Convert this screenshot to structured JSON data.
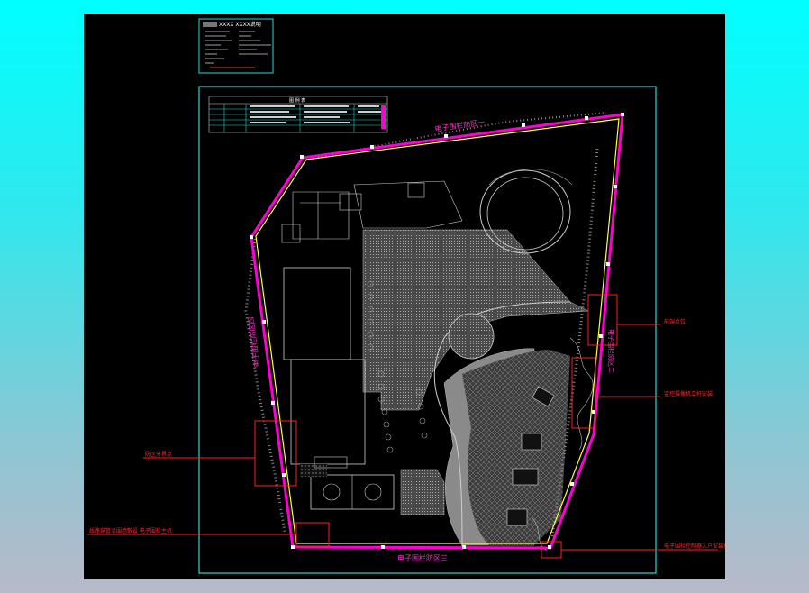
{
  "drawing": {
    "boundary_labels": {
      "north": "电子围栏防区一",
      "west": "电子围栏防区四",
      "south": "电子围栏防区三",
      "east": "电子围栏防区二"
    },
    "callouts": {
      "c1": "前端点位",
      "c2": "监控摄像机立杆安装",
      "c3": "防区分界点",
      "c4": "线路穿管沿围墙敷设 电子围栏主机",
      "c5": "电子围栏控制器入户安装位置"
    },
    "title_block": {
      "header": "XXXX XXXX说明"
    },
    "legend_table": {
      "title": "图 例 表"
    }
  },
  "colors": {
    "background": "#000000",
    "frame": "#27d8d8",
    "fence_outer": "#ff00d2",
    "fence_inner": "#ffff33",
    "callout": "#ff2020",
    "linework": "#d0d0d0",
    "hatch": "#7a7a7a"
  }
}
